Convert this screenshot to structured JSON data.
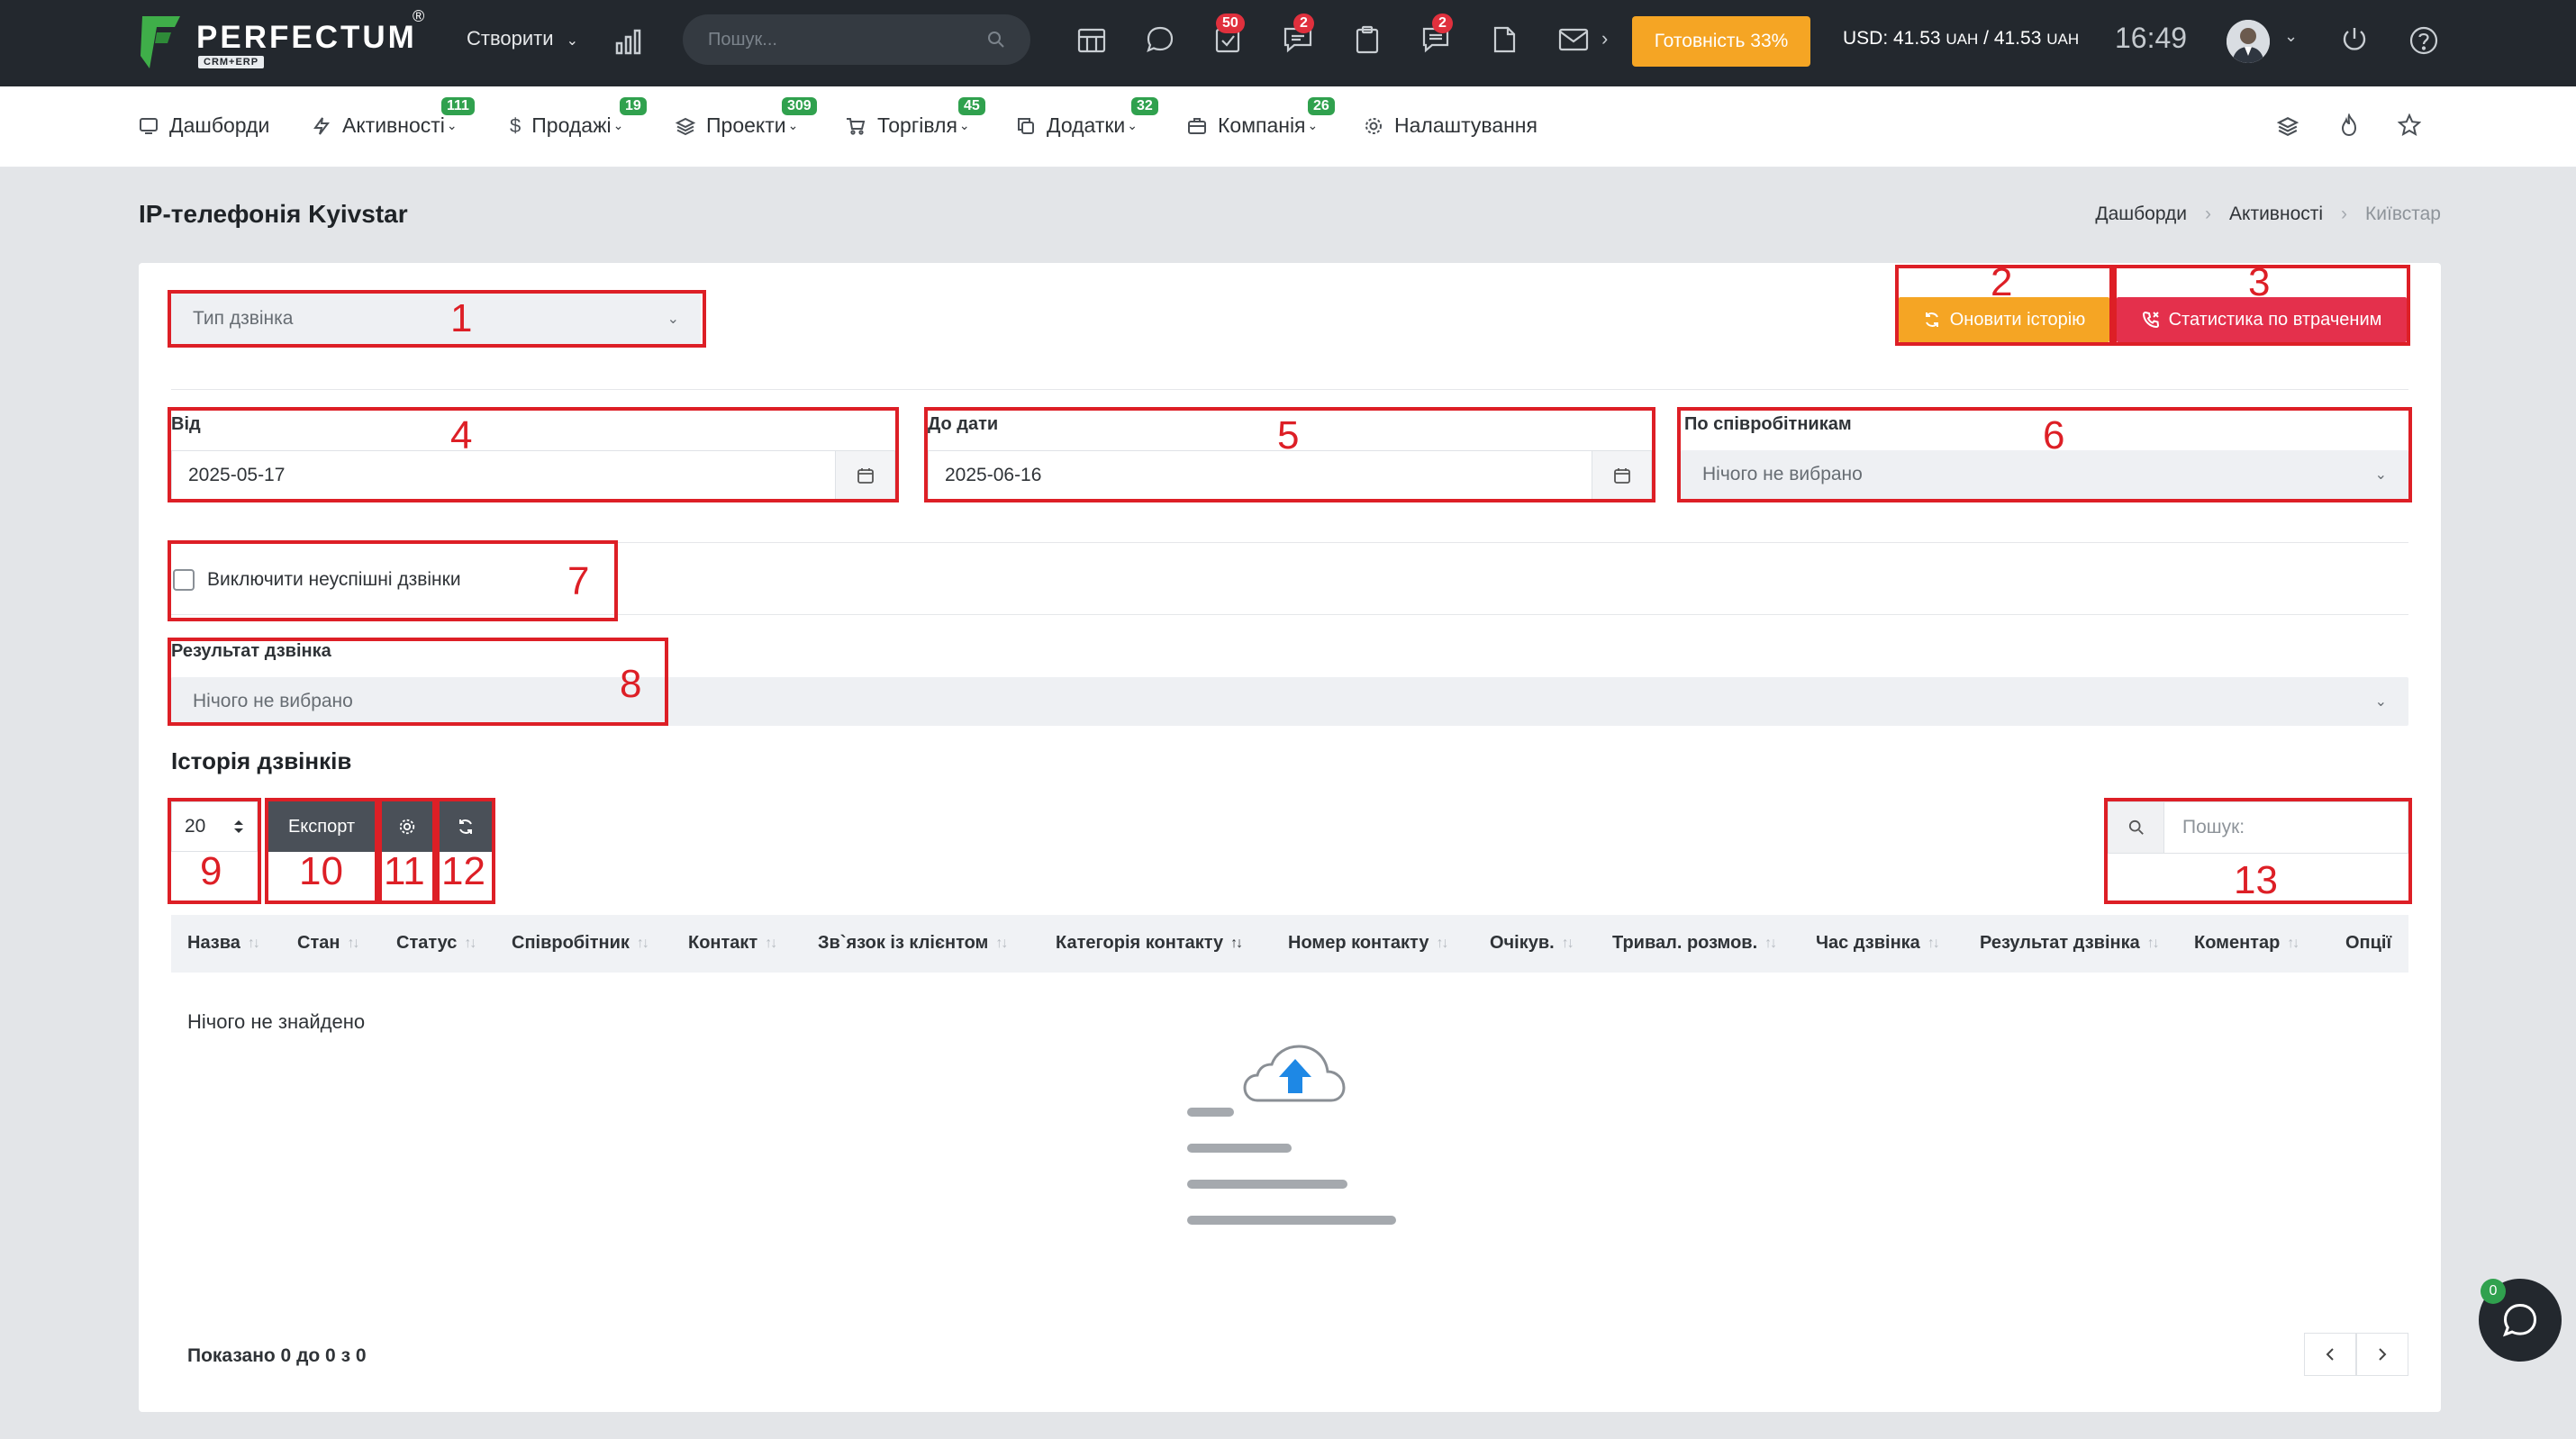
{
  "app": {
    "brand": "PERFECTUM",
    "brand_sub": "CRM+ERP",
    "brand_reg": "®"
  },
  "topbar": {
    "create_label": "Створити",
    "search_placeholder": "Пошук...",
    "badges": {
      "tasks": "50",
      "messages": "2",
      "comments": "2"
    },
    "readiness_label": "Готовність 33%",
    "currency_main": "USD: 41.53",
    "currency_unit": "UAH",
    "currency_alt": "41.53",
    "time": "16:49"
  },
  "nav": {
    "items": [
      {
        "label": "Дашборди",
        "icon": "dashboard-icon",
        "badge": ""
      },
      {
        "label": "Активності",
        "icon": "bolt-icon",
        "badge": "111"
      },
      {
        "label": "Продажі",
        "icon": "dollar-icon",
        "badge": "19"
      },
      {
        "label": "Проекти",
        "icon": "layers-icon",
        "badge": "309"
      },
      {
        "label": "Торгівля",
        "icon": "cart-icon",
        "badge": "45"
      },
      {
        "label": "Додатки",
        "icon": "copy-icon",
        "badge": "32"
      },
      {
        "label": "Компанія",
        "icon": "briefcase-icon",
        "badge": "26"
      },
      {
        "label": "Налаштування",
        "icon": "gear-icon",
        "badge": ""
      }
    ]
  },
  "page": {
    "title": "IP-телефонія Kyivstar",
    "breadcrumbs": [
      "Дашборди",
      "Активності",
      "Київстар"
    ]
  },
  "filters": {
    "call_type_placeholder": "Тип дзвінка",
    "refresh_history_label": "Оновити історію",
    "lost_stats_label": "Статистика по втраченим",
    "from_label": "Від",
    "from_value": "2025-05-17",
    "to_label": "До дати",
    "to_value": "2025-06-16",
    "employees_label": "По співробітникам",
    "employees_value": "Нічого не вибрано",
    "exclude_failed_label": "Виключити неуспішні дзвінки",
    "result_label": "Результат дзвінка",
    "result_value": "Нічого не вибрано"
  },
  "history": {
    "title": "Історія дзвінків",
    "per_page": "20",
    "export_label": "Експорт",
    "search_placeholder": "Пошук:",
    "columns": [
      "Назва",
      "Стан",
      "Статус",
      "Співробітник",
      "Контакт",
      "Зв`язок із клієнтом",
      "Категорія контакту",
      "Номер контакту",
      "Очікув.",
      "Тривал. розмов.",
      "Час дзвінка",
      "Результат дзвінка",
      "Коментар",
      "Опції"
    ],
    "empty_text": "Нічого не знайдено",
    "footer_info": "Показано 0 до 0 з 0"
  },
  "annotations": [
    "1",
    "2",
    "3",
    "4",
    "5",
    "6",
    "7",
    "8",
    "9",
    "10",
    "11",
    "12",
    "13"
  ],
  "chat_badge": "0",
  "colors": {
    "accent_orange": "#f5a524",
    "accent_red": "#e4304c",
    "annotation_red": "#dd1f26",
    "badge_green": "#30a14e",
    "badge_red": "#e0303d",
    "topbar_bg": "#23282e"
  }
}
